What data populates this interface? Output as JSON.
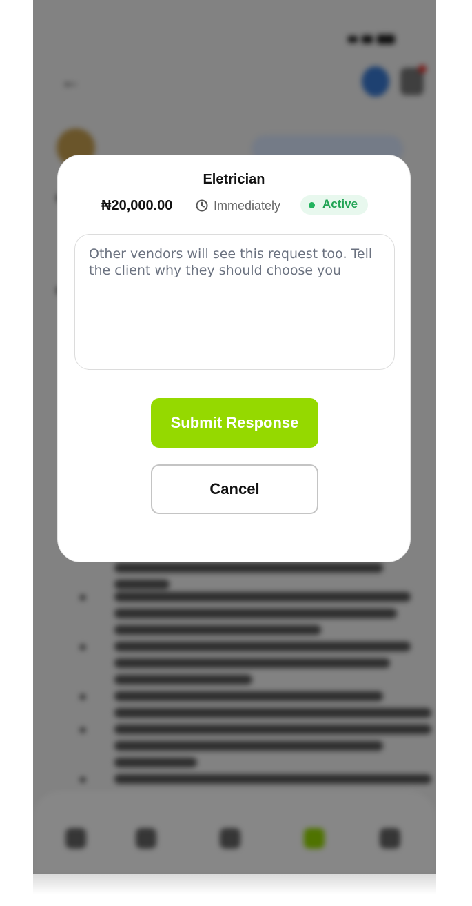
{
  "modal": {
    "title": "Eletrician",
    "price": "₦20,000.00",
    "timing": "Immediately",
    "status": "Active",
    "response_placeholder": "Other vendors will see this request too. Tell the client why they should choose you",
    "response_value": "",
    "submit_label": "Submit Response",
    "cancel_label": "Cancel"
  },
  "colors": {
    "submit_bg": "#95d900",
    "status_text": "#22a455",
    "status_bg": "#e8f8ee"
  },
  "icons": {
    "timing": "clock-icon",
    "status": "status-dot"
  }
}
